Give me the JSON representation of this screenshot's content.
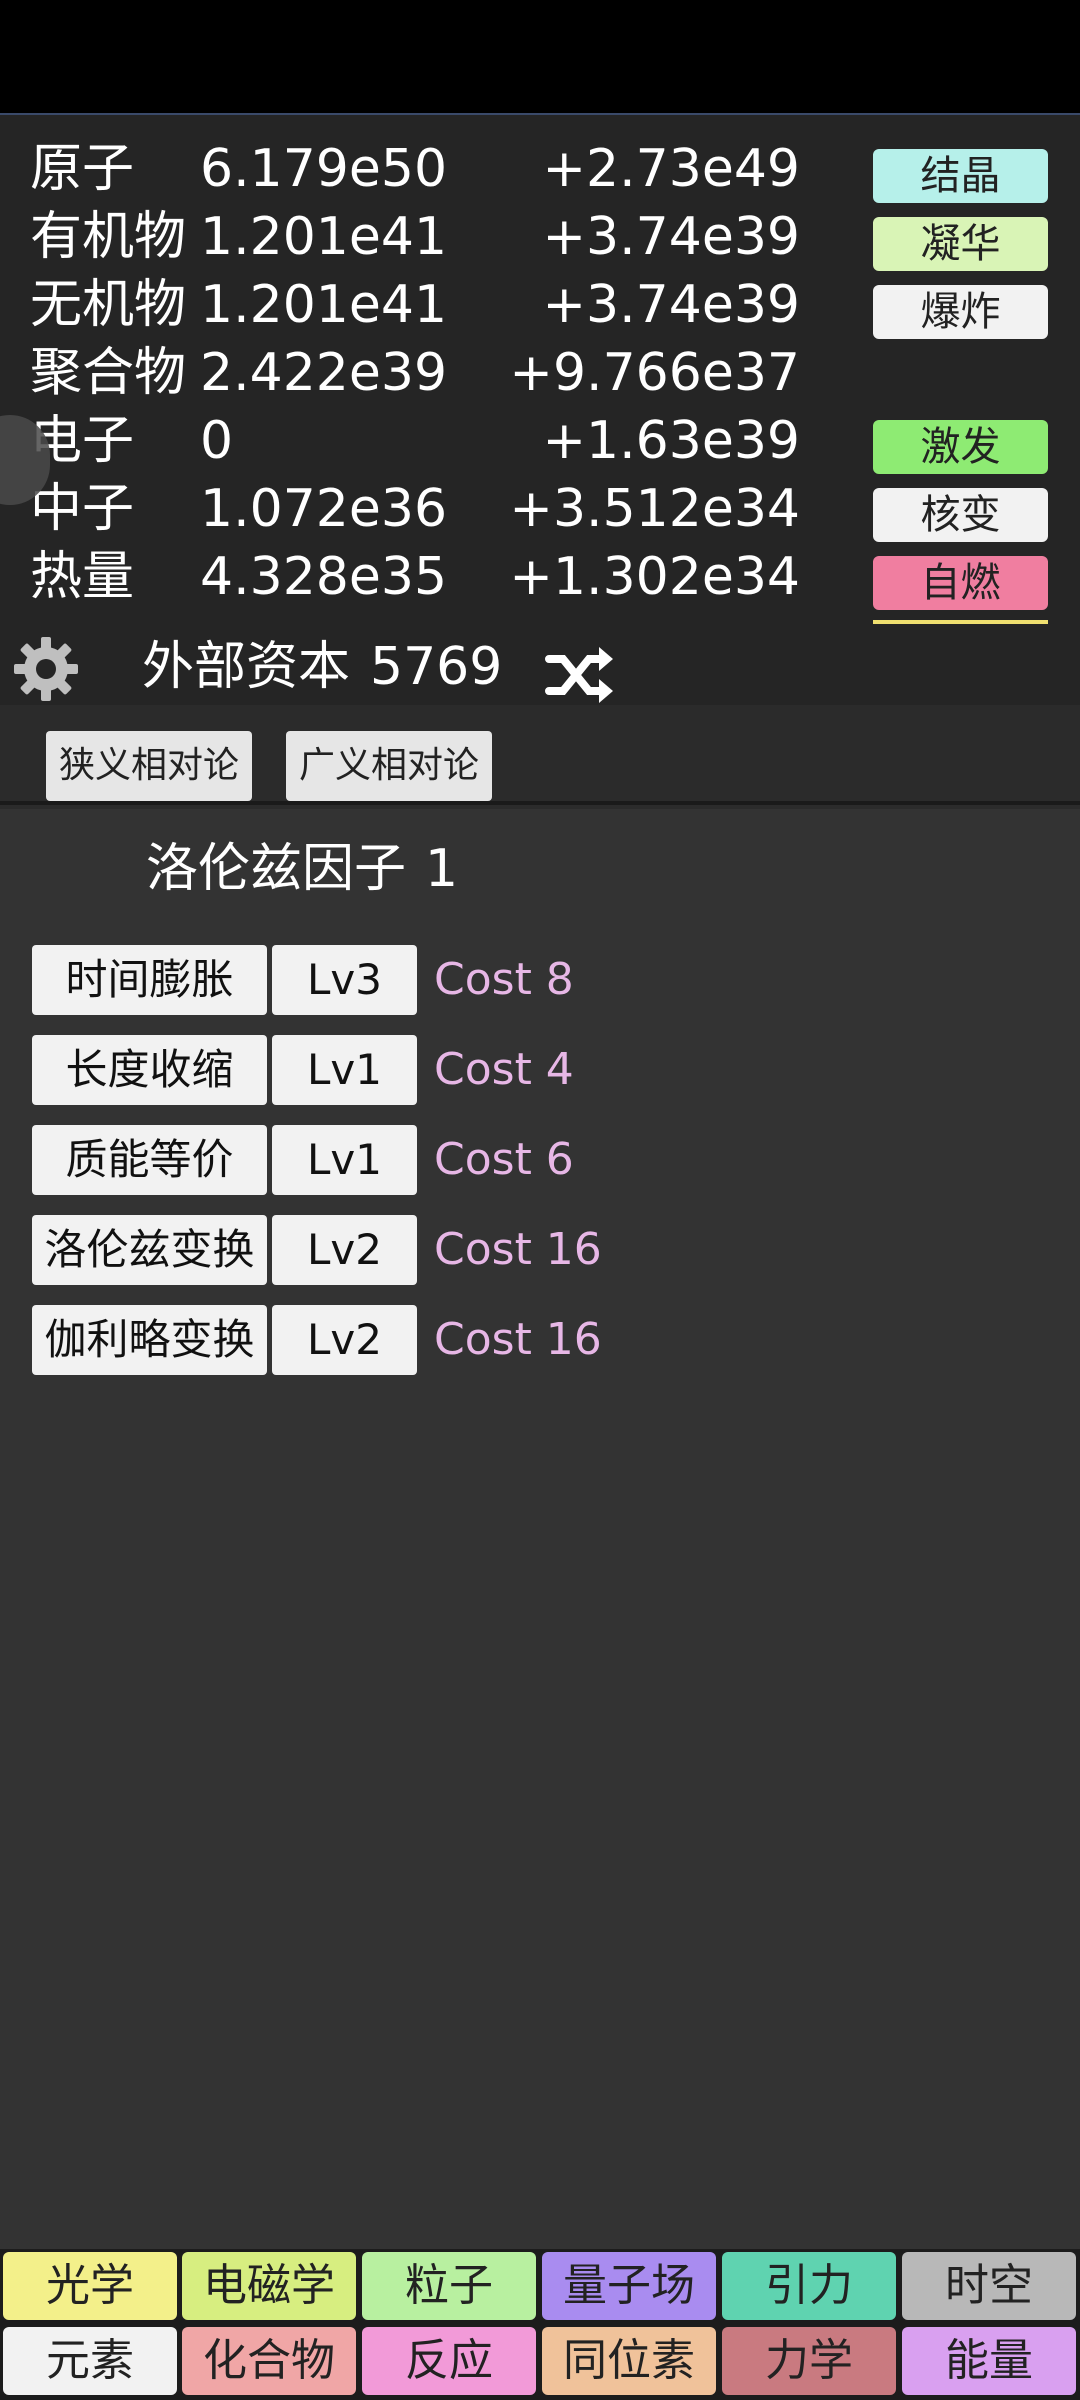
{
  "resources": [
    {
      "name": "原子",
      "amount": "6.179e50",
      "rate": "+2.73e49"
    },
    {
      "name": "有机物",
      "amount": "1.201e41",
      "rate": "+3.74e39"
    },
    {
      "name": "无机物",
      "amount": "1.201e41",
      "rate": "+3.74e39"
    },
    {
      "name": "聚合物",
      "amount": "2.422e39",
      "rate": "+9.766e37"
    },
    {
      "name": "电子",
      "amount": "0",
      "rate": "+1.63e39"
    },
    {
      "name": "中子",
      "amount": "1.072e36",
      "rate": "+3.512e34"
    },
    {
      "name": "热量",
      "amount": "4.328e35",
      "rate": "+1.302e34"
    }
  ],
  "actions": [
    {
      "label": "结晶",
      "color": "#b6f0ea"
    },
    {
      "label": "凝华",
      "color": "#d9f4b6"
    },
    {
      "label": "爆炸",
      "color": "#f2f2f2"
    },
    {
      "label": "激发",
      "color": "#8eeb73"
    },
    {
      "label": "核变",
      "color": "#f2f2f2"
    },
    {
      "label": "自燃",
      "color": "#f07ea0"
    }
  ],
  "capital": {
    "label": "外部资本",
    "value": "5769"
  },
  "tabs": [
    "狭义相对论",
    "广义相对论"
  ],
  "factor": {
    "label": "洛伦兹因子",
    "value": "1"
  },
  "upgrades": [
    {
      "name": "时间膨胀",
      "level": "Lv3",
      "cost": "Cost 8"
    },
    {
      "name": "长度收缩",
      "level": "Lv1",
      "cost": "Cost 4"
    },
    {
      "name": "质能等价",
      "level": "Lv1",
      "cost": "Cost 6"
    },
    {
      "name": "洛伦兹变换",
      "level": "Lv2",
      "cost": "Cost 16"
    },
    {
      "name": "伽利略变换",
      "level": "Lv2",
      "cost": "Cost 16"
    }
  ],
  "nav_row1": [
    {
      "label": "光学",
      "color": "#f3f08a"
    },
    {
      "label": "电磁学",
      "color": "#d7ee80"
    },
    {
      "label": "粒子",
      "color": "#b8f0a0"
    },
    {
      "label": "量子场",
      "color": "#a98cf0"
    },
    {
      "label": "引力",
      "color": "#5fd3b0"
    },
    {
      "label": "时空",
      "color": "#b8b8b8"
    }
  ],
  "nav_row2": [
    {
      "label": "元素",
      "color": "#f2f2f2"
    },
    {
      "label": "化合物",
      "color": "#f0a6a6"
    },
    {
      "label": "反应",
      "color": "#f29ad8"
    },
    {
      "label": "同位素",
      "color": "#f0c29a"
    },
    {
      "label": "力学",
      "color": "#c97a80"
    },
    {
      "label": "能量",
      "color": "#d9a0f0"
    }
  ]
}
